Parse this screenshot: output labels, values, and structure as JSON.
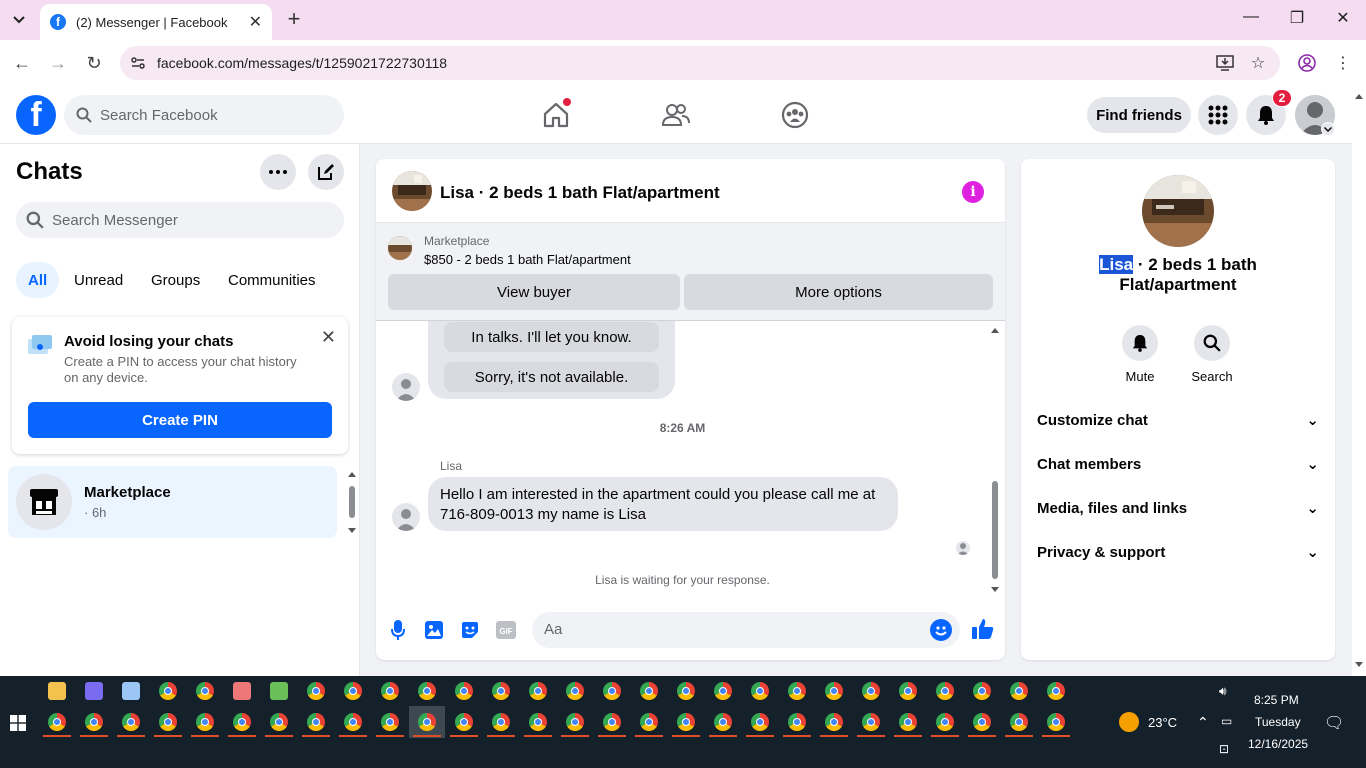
{
  "browser": {
    "tab_title": "(2) Messenger | Facebook",
    "url": "facebook.com/messages/t/1259021722730118"
  },
  "fb_header": {
    "search_placeholder": "Search Facebook",
    "find_friends": "Find friends",
    "notifications_count": "2"
  },
  "left": {
    "title": "Chats",
    "search_placeholder": "Search Messenger",
    "filters": [
      "All",
      "Unread",
      "Groups",
      "Communities"
    ],
    "pin_card": {
      "title": "Avoid losing your chats",
      "desc": "Create a PIN to access your chat history on any device.",
      "button": "Create PIN"
    },
    "conversation": {
      "name": "Marketplace",
      "time": "· 6h"
    }
  },
  "chat": {
    "title": "Lisa · 2 beds 1 bath Flat/apartment",
    "marketplace_label": "Marketplace",
    "listing": "$850 - 2 beds 1 bath Flat/apartment",
    "view_buyer": "View buyer",
    "more_options": "More options",
    "quick_reply_1": "In talks. I'll let you know.",
    "quick_reply_2": "Sorry, it's not available.",
    "timestamp": "8:26 AM",
    "sender": "Lisa",
    "message": "Hello I am interested in the apartment could you please call me at 716-809-0013 my name is Lisa",
    "waiting": "Lisa is waiting for your response.",
    "composer_placeholder": "Aa"
  },
  "right": {
    "name_highlight": "Lisa",
    "name_rest_1": " · 2 beds 1 bath",
    "name_rest_2": "Flat/apartment",
    "mute": "Mute",
    "search": "Search",
    "sections": [
      "Customize chat",
      "Chat members",
      "Media, files and links",
      "Privacy & support"
    ]
  },
  "taskbar": {
    "temperature": "23°C",
    "time": "8:25 PM",
    "day": "Tuesday",
    "date": "12/16/2025"
  },
  "colors": {
    "fb_blue": "#0866ff",
    "taskbar": "#14202a",
    "tab_strip": "#f6dcf1",
    "info_magenta": "#e020e0"
  }
}
